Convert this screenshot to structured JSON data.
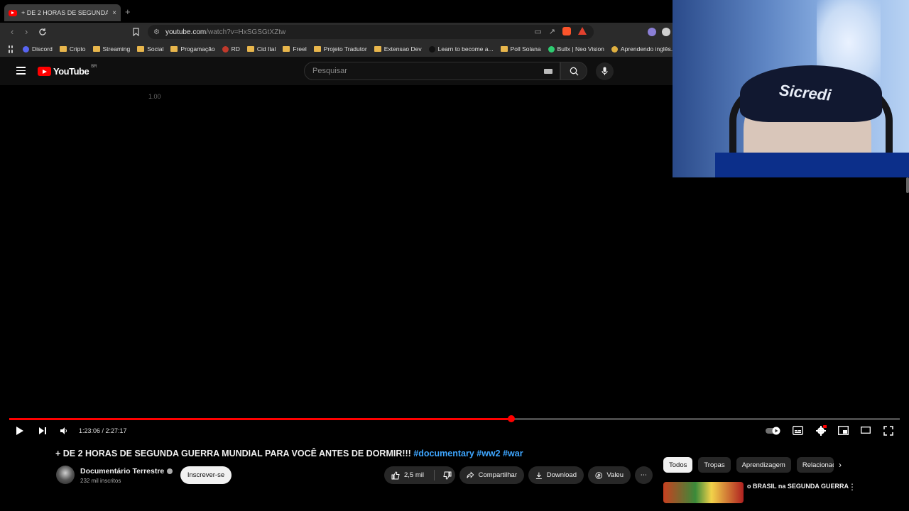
{
  "browser": {
    "tab_title": "+ DE 2 HORAS DE SEGUNDA GU",
    "tab_close": "×",
    "new_tab": "+",
    "url_host": "youtube.com",
    "url_path": "/watch?v=HxSGSGtXZtw",
    "bookmarks": [
      {
        "label": "Discord",
        "icon": "discord-icon",
        "color": "#5865f2"
      },
      {
        "label": "Cripto",
        "icon": "folder-icon"
      },
      {
        "label": "Streaming",
        "icon": "folder-icon"
      },
      {
        "label": "Social",
        "icon": "folder-icon"
      },
      {
        "label": "Progamação",
        "icon": "folder-icon"
      },
      {
        "label": "RD",
        "icon": "rd-icon",
        "color": "#c0392b"
      },
      {
        "label": "Cid Ital",
        "icon": "folder-icon"
      },
      {
        "label": "Freel",
        "icon": "folder-icon"
      },
      {
        "label": "Projeto Tradutor",
        "icon": "folder-icon"
      },
      {
        "label": "Extensao Dev",
        "icon": "folder-icon"
      },
      {
        "label": "Learn to become a...",
        "icon": "site-icon",
        "color": "#111111"
      },
      {
        "label": "Poll Solana",
        "icon": "folder-icon"
      },
      {
        "label": "Bullx | Neo Vision",
        "icon": "bullx-icon",
        "color": "#2ecc71"
      },
      {
        "label": "Aprendendo inglês...",
        "icon": "site-icon",
        "color": "#e0b040"
      }
    ]
  },
  "youtube": {
    "logo_text": "YouTube",
    "region": "BR",
    "search_placeholder": "Pesquisar"
  },
  "player": {
    "speed_overlay": "1.00",
    "current_time": "1:23:06",
    "duration": "2:27:17",
    "time_display": "1:23:06 / 2:27:17",
    "progress_fraction": 0.564,
    "accent_color": "#ff0000"
  },
  "video": {
    "title": "+ DE 2 HORAS DE SEGUNDA GUERRA MUNDIAL PARA VOCÊ ANTES DE DORMIR!!!",
    "hashtags": "#documentary #ww2 #war",
    "channel_name": "Documentário Terrestre",
    "subscribers": "232 mil inscritos",
    "subscribe_label": "Inscrever-se",
    "like_count": "2,5 mil",
    "share_label": "Compartilhar",
    "download_label": "Download",
    "thanks_label": "Valeu",
    "more_label": "⋯"
  },
  "sidebar": {
    "chips": [
      {
        "label": "Todos",
        "active": true
      },
      {
        "label": "Tropas",
        "active": false
      },
      {
        "label": "Aprendizagem",
        "active": false
      },
      {
        "label": "Relacionad",
        "active": false
      }
    ],
    "rec_title": "o BRASIL na SEGUNDA GUERRA"
  },
  "webcam": {
    "cap_text": "Sicredi"
  }
}
